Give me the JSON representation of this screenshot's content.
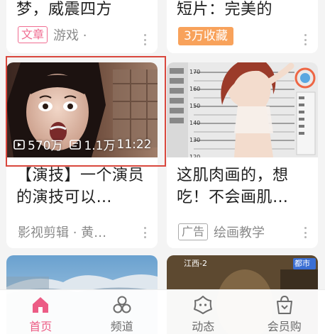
{
  "top_left_card": {
    "title": "梦，威震四方",
    "tag": "文章",
    "meta": "游戏 ·"
  },
  "top_right_card": {
    "title": "短片：完美的",
    "badge": "3万收藏"
  },
  "video_card": {
    "plays": "570万",
    "danmaku": "1.1万",
    "duration": "11:22",
    "title": "【演技】一个演员的演技可以…",
    "meta": "影视剪辑 · 黄…"
  },
  "ad_card": {
    "title": "这肌肉画的，想吃！不会画肌…",
    "tag": "广告",
    "meta": "绘画教学",
    "ruler_marks": [
      "170",
      "160",
      "150",
      "140",
      "130",
      "120"
    ]
  },
  "bottom_right_preview": {
    "logo_text": "都市",
    "channel_text": "江西-2"
  },
  "tabbar": {
    "items": [
      {
        "label": "首页",
        "icon": "home-icon",
        "active": true
      },
      {
        "label": "频道",
        "icon": "channel-icon",
        "active": false
      },
      {
        "label": "动态",
        "icon": "dynamic-icon",
        "active": false
      },
      {
        "label": "会员购",
        "icon": "shop-bag-icon",
        "active": false
      }
    ]
  },
  "colors": {
    "accent": "#ec5c85",
    "badge_orange": "#f8a25b",
    "highlight_border": "#d9473d"
  }
}
